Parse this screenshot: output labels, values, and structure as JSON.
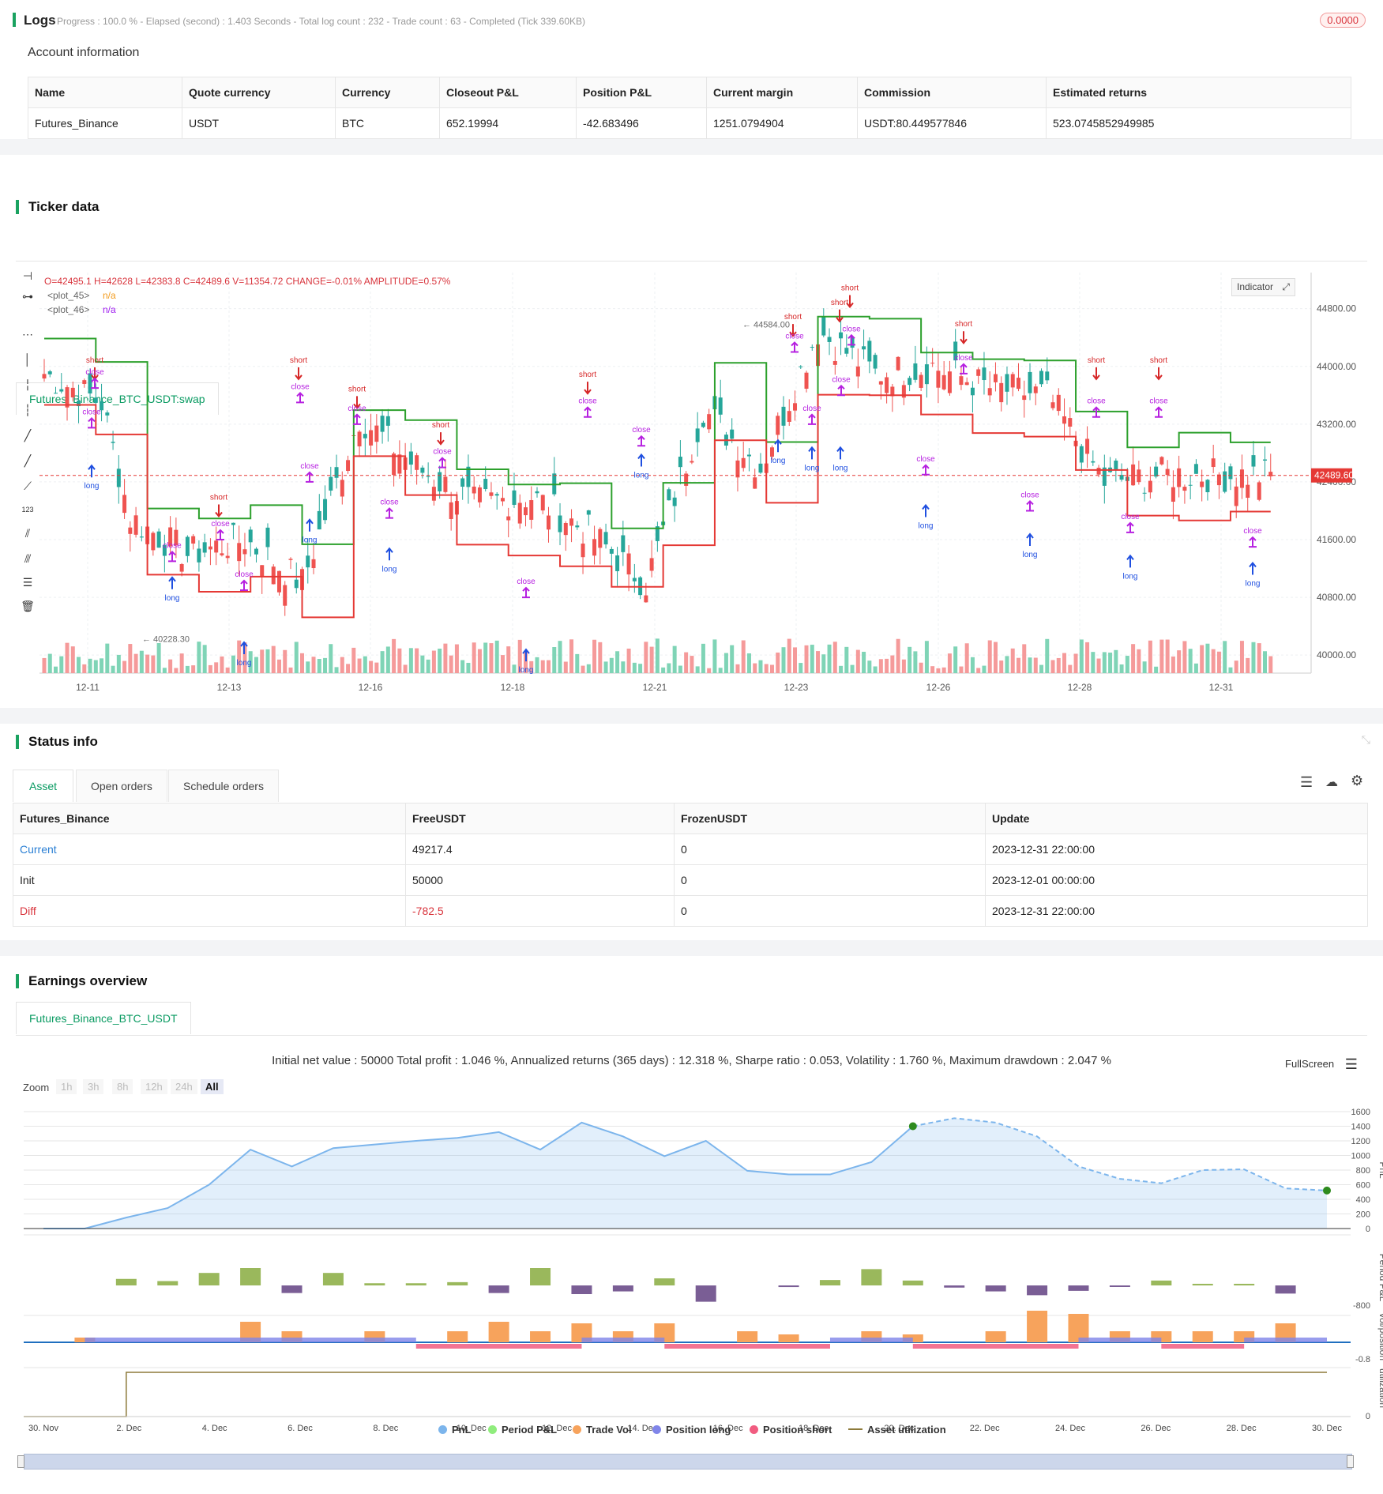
{
  "logs": {
    "title": "Logs",
    "summary": "Progress : 100.0 % - Elapsed (second) : 1.403  Seconds - Total log count : 232 - Trade count : 63 - Completed (Tick 339.60KB)",
    "badge": "0.0000"
  },
  "account": {
    "heading": "Account information",
    "columns": [
      "Name",
      "Quote currency",
      "Currency",
      "Closeout P&L",
      "Position P&L",
      "Current margin",
      "Commission",
      "Estimated returns"
    ],
    "row": [
      "Futures_Binance",
      "USDT",
      "BTC",
      "652.19994",
      "-42.683496",
      "1251.0794904",
      "USDT:80.449577846",
      "523.0745852949985"
    ]
  },
  "ticker": {
    "title": "Ticker data",
    "tab": "Futures_Binance_BTC_USDT:swap",
    "ohlc_prefix": "O=",
    "ohlc": "O=42495.1 H=42628 L=42383.8 C=42489.6 V=11354.72 CHANGE=-0.01% AMPLITUDE=0.57%",
    "plot45": "<plot_45>",
    "plot46": "<plot_46>",
    "na": "n/a",
    "indicator_btn": "Indicator",
    "price_labels": [
      "44800.00",
      "44000.00",
      "43200.00",
      "42400.00",
      "41600.00",
      "40800.00",
      "40000.00"
    ],
    "current_price": "42489.60",
    "max_label": "44584.00",
    "min_label": "40228.30",
    "x_labels": [
      "12-11",
      "12-13",
      "12-16",
      "12-18",
      "12-21",
      "12-23",
      "12-26",
      "12-28",
      "12-31"
    ],
    "marker_short": "short",
    "marker_long": "long",
    "marker_close": "close"
  },
  "status": {
    "title": "Status info",
    "tabs": [
      "Asset",
      "Open orders",
      "Schedule orders"
    ],
    "columns": [
      "Futures_Binance",
      "FreeUSDT",
      "FrozenUSDT",
      "Update"
    ],
    "rows": [
      [
        "Current",
        "49217.4",
        "0",
        "2023-12-31 22:00:00"
      ],
      [
        "Init",
        "50000",
        "0",
        "2023-12-01 00:00:00"
      ],
      [
        "Diff",
        "-782.5",
        "0",
        "2023-12-31 22:00:00"
      ]
    ]
  },
  "earnings": {
    "title": "Earnings overview",
    "tab": "Futures_Binance_BTC_USDT",
    "summary": "Initial net value : 50000 Total profit : 1.046 %, Annualized returns (365 days) : 12.318 %, Sharpe ratio : 0.053, Volatility : 1.760 %, Maximum drawdown : 2.047 %",
    "fullscreen": "FullScreen",
    "zoom_label": "Zoom",
    "zoom_buttons": [
      "1h",
      "3h",
      "8h",
      "12h",
      "24h",
      "All"
    ],
    "pnl_axis": [
      "1600",
      "1400",
      "1200",
      "1000",
      "800",
      "600",
      "400",
      "200",
      "0"
    ],
    "axis_titles": [
      "PnL",
      "Period P&L",
      "vol/position",
      "utilization"
    ],
    "period_min": "-800",
    "vol_min": "-0.8",
    "util_zero": "0",
    "x_labels": [
      "30. Nov",
      "2. Dec",
      "4. Dec",
      "6. Dec",
      "8. Dec",
      "10. Dec",
      "12. Dec",
      "14. Dec",
      "16. Dec",
      "18. Dec",
      "20. Dec",
      "22. Dec",
      "24. Dec",
      "26. Dec",
      "28. Dec",
      "30. Dec"
    ],
    "legend": [
      "PnL",
      "Period P&L",
      "Trade Vol",
      "Position long",
      "Position short",
      "Asset utilization"
    ],
    "colors": {
      "pnl": "#7cb5ec",
      "period": "#90ed7d",
      "vol": "#f7a35c",
      "long": "#8085e9",
      "short": "#f15c80",
      "util": "#8d7a3a"
    }
  },
  "chart_data": [
    {
      "type": "line",
      "title": "",
      "ylabel": "PnL",
      "x": [
        "30. Nov",
        "1. Dec",
        "2. Dec",
        "3. Dec",
        "4. Dec",
        "5. Dec",
        "6. Dec",
        "7. Dec",
        "8. Dec",
        "9. Dec",
        "10. Dec",
        "11. Dec",
        "12. Dec",
        "13. Dec",
        "14. Dec",
        "15. Dec",
        "16. Dec",
        "17. Dec",
        "18. Dec",
        "19. Dec",
        "20. Dec",
        "21. Dec",
        "22. Dec",
        "23. Dec",
        "24. Dec",
        "25. Dec",
        "26. Dec",
        "27. Dec",
        "28. Dec",
        "29. Dec",
        "30. Dec",
        "31. Dec"
      ],
      "series": [
        {
          "name": "PnL",
          "values": [
            0,
            0,
            150,
            280,
            600,
            1080,
            850,
            1100,
            1150,
            1200,
            1240,
            1320,
            1080,
            1450,
            1260,
            990,
            1200,
            790,
            740,
            740,
            910,
            1400,
            1510,
            1450,
            1260,
            850,
            680,
            620,
            800,
            810,
            550,
            520
          ]
        }
      ],
      "ylim": [
        0,
        1600
      ]
    },
    {
      "type": "bar",
      "ylabel": "Period P&L",
      "series": [
        {
          "name": "Period P&L",
          "values": [
            0,
            0,
            120,
            80,
            230,
            320,
            -140,
            230,
            40,
            40,
            60,
            -140,
            320,
            -160,
            -110,
            130,
            -300,
            0,
            -30,
            100,
            300,
            90,
            -40,
            -110,
            -180,
            -100,
            -20,
            90,
            30,
            30,
            -150,
            0
          ]
        }
      ]
    }
  ]
}
